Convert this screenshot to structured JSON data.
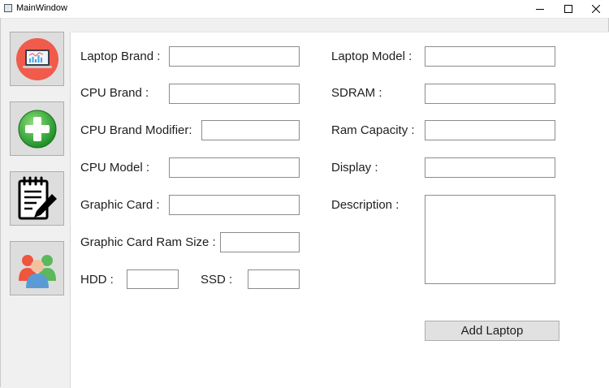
{
  "window": {
    "title": "MainWindow"
  },
  "sidebar": {
    "items": [
      {
        "name": "laptop-dashboard",
        "icon": "laptop-chart-icon"
      },
      {
        "name": "add",
        "icon": "green-plus-icon"
      },
      {
        "name": "notes",
        "icon": "notepad-pencil-icon"
      },
      {
        "name": "users",
        "icon": "users-group-icon"
      }
    ]
  },
  "form": {
    "laptop_brand": {
      "label": "Laptop Brand :",
      "value": ""
    },
    "cpu_brand": {
      "label": "CPU Brand :",
      "value": ""
    },
    "cpu_brand_modifier": {
      "label": "CPU Brand Modifier:",
      "value": ""
    },
    "cpu_model": {
      "label": "CPU Model :",
      "value": ""
    },
    "graphic_card": {
      "label": "Graphic Card :",
      "value": ""
    },
    "graphic_card_ram_size": {
      "label": "Graphic Card Ram Size :",
      "value": ""
    },
    "hdd": {
      "label": "HDD :",
      "value": ""
    },
    "ssd": {
      "label": "SSD :",
      "value": ""
    },
    "laptop_model": {
      "label": "Laptop Model :",
      "value": ""
    },
    "sdram": {
      "label": "SDRAM :",
      "value": ""
    },
    "ram_capacity": {
      "label": "Ram Capacity :",
      "value": ""
    },
    "display": {
      "label": "Display :",
      "value": ""
    },
    "description": {
      "label": "Description :",
      "value": ""
    },
    "add_button": "Add Laptop"
  },
  "colors": {
    "laptop_icon_bg": "#f15b4b",
    "plus_icon": "#3fb43f",
    "panel_bg": "#ffffff",
    "window_bg": "#f0f0f0"
  }
}
